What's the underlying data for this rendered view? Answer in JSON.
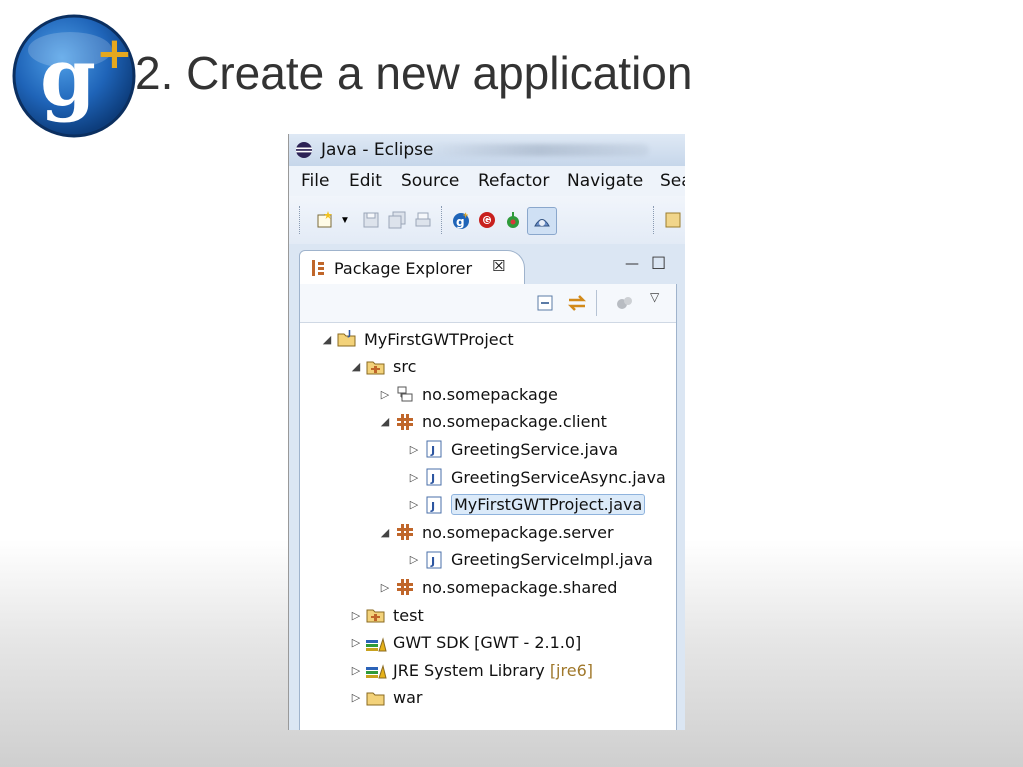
{
  "slide": {
    "title": "2. Create a new application",
    "logo_text": "g+"
  },
  "window": {
    "title": "Java - Eclipse",
    "menu": [
      "File",
      "Edit",
      "Source",
      "Refactor",
      "Navigate",
      "Sea"
    ]
  },
  "toolbar": {
    "icons": [
      "new-wizard-icon",
      "save-icon",
      "save-all-icon",
      "print-icon",
      "gwt-google-icon",
      "gwt-compile-icon",
      "gwt-dev-mode-icon",
      "gwt-deploy-icon",
      "open-type-icon"
    ]
  },
  "view": {
    "tab_label": "Package Explorer",
    "close_glyph": "☒",
    "minimize_glyph": "—",
    "maximize_glyph": "☐"
  },
  "tree": [
    {
      "label": "MyFirstGWTProject",
      "icon": "project-icon",
      "arrow": "◢",
      "suffix": ""
    },
    {
      "label": "src",
      "icon": "source-folder-icon",
      "arrow": "◢",
      "suffix": ""
    },
    {
      "label": "no.somepackage",
      "icon": "package-empty-icon",
      "arrow": "▷",
      "suffix": ""
    },
    {
      "label": "no.somepackage.client",
      "icon": "package-icon",
      "arrow": "◢",
      "suffix": ""
    },
    {
      "label": "GreetingService.java",
      "icon": "java-file-icon",
      "arrow": "▷",
      "suffix": ""
    },
    {
      "label": "GreetingServiceAsync.java",
      "icon": "java-file-icon",
      "arrow": "▷",
      "suffix": ""
    },
    {
      "label": "MyFirstGWTProject.java",
      "icon": "java-file-icon",
      "arrow": "▷",
      "suffix": ""
    },
    {
      "label": "no.somepackage.server",
      "icon": "package-icon",
      "arrow": "◢",
      "suffix": ""
    },
    {
      "label": "GreetingServiceImpl.java",
      "icon": "java-file-icon",
      "arrow": "▷",
      "suffix": ""
    },
    {
      "label": "no.somepackage.shared",
      "icon": "package-icon",
      "arrow": "▷",
      "suffix": ""
    },
    {
      "label": "test",
      "icon": "source-folder-icon",
      "arrow": "▷",
      "suffix": ""
    },
    {
      "label": "GWT SDK [GWT - 2.1.0]",
      "icon": "library-icon",
      "arrow": "▷",
      "suffix": ""
    },
    {
      "label": "JRE System Library ",
      "icon": "library-icon",
      "arrow": "▷",
      "suffix": "[jre6]"
    },
    {
      "label": "war",
      "icon": "folder-icon",
      "arrow": "▷",
      "suffix": ""
    }
  ],
  "selected_item": "MyFirstGWTProject.java",
  "colors": {
    "title": "#333333",
    "selection": "#dbeaf9",
    "package": "#c0662a",
    "jre_suffix": "#a0782b"
  }
}
